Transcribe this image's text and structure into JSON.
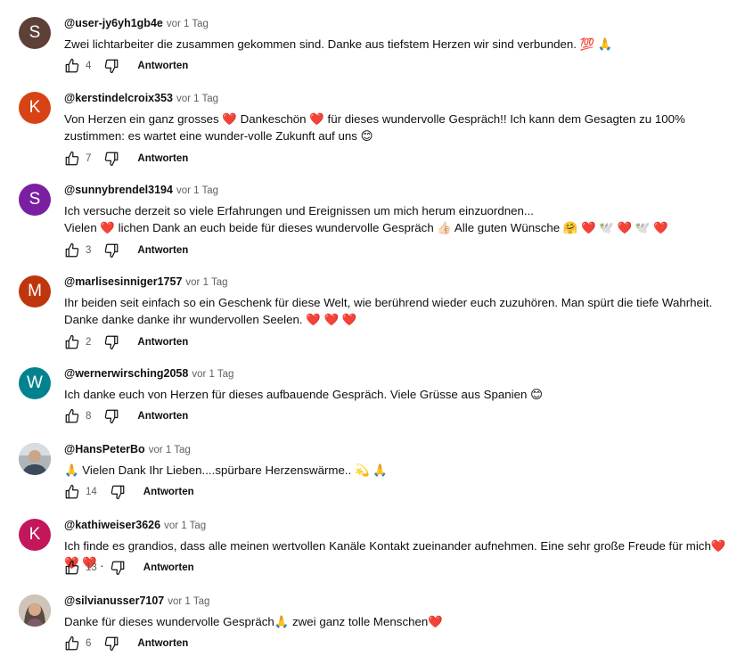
{
  "ui": {
    "reply_label": "Antworten"
  },
  "comments": [
    {
      "avatar_letter": "S",
      "avatar_color": "#5d4037",
      "handle": "@user-jy6yh1gb4e",
      "time": "vor 1 Tag",
      "text": "Zwei lichtarbeiter die zusammen gekommen sind. Danke aus tiefstem Herzen wir sind verbunden. 💯 🙏",
      "likes": "4"
    },
    {
      "avatar_letter": "K",
      "avatar_color": "#d84315",
      "handle": "@kerstindelcroix353",
      "time": "vor 1 Tag",
      "text": "Von Herzen ein ganz grosses ❤️ Dankeschön ❤️  für dieses wundervolle Gespräch!! Ich kann dem Gesagten zu 100% zustimmen: es wartet eine wunder-volle Zukunft auf uns 😊",
      "likes": "7"
    },
    {
      "avatar_letter": "S",
      "avatar_color": "#7b1fa2",
      "handle": "@sunnybrendel3194",
      "time": "vor 1 Tag",
      "text": "Ich versuche derzeit so viele Erfahrungen und Ereignissen um mich herum einzuordnen...\nVielen ❤️ lichen Dank an euch beide für dieses wundervolle Gespräch 👍🏻 Alle guten Wünsche 🤗 ❤️ 🕊️ ❤️ 🕊️ ❤️",
      "likes": "3"
    },
    {
      "avatar_letter": "M",
      "avatar_color": "#bf360c",
      "handle": "@marlisesinniger1757",
      "time": "vor 1 Tag",
      "text": "Ihr beiden seit einfach so ein Geschenk für diese Welt, wie berührend wieder euch zuzuhören. Man spürt die tiefe Wahrheit. Danke danke danke ihr wundervollen Seelen. ❤️ ❤️ ❤️",
      "likes": "2"
    },
    {
      "avatar_letter": "W",
      "avatar_color": "#00838f",
      "handle": "@wernerwirsching2058",
      "time": "vor 1 Tag",
      "text": "Ich danke euch von Herzen für dieses aufbauende Gespräch. Viele Grüsse aus Spanien 😊",
      "likes": "8"
    },
    {
      "avatar_letter": "",
      "avatar_color": "#8d8d8d",
      "handle": "@HansPeterBo",
      "time": "vor 1 Tag",
      "text": "🙏  Vielen Dank Ihr Lieben....spürbare Herzenswärme..  💫 🙏",
      "likes": "14"
    },
    {
      "avatar_letter": "K",
      "avatar_color": "#c2185b",
      "handle": "@kathiweiser3626",
      "time": "vor 1 Tag",
      "text": "Ich finde es grandios, dass alle meinen wertvollen Kanäle Kontakt zueinander aufnehmen. Eine sehr große Freude für mich❤️ ❤️ ❤️ .",
      "likes": "13"
    },
    {
      "avatar_letter": "",
      "avatar_color": "#a1887f",
      "handle": "@silvianusser7107",
      "time": "vor 1 Tag",
      "text": "Danke für dieses wundervolle Gespräch🙏  zwei ganz tolle Menschen❤️",
      "likes": "6"
    }
  ]
}
